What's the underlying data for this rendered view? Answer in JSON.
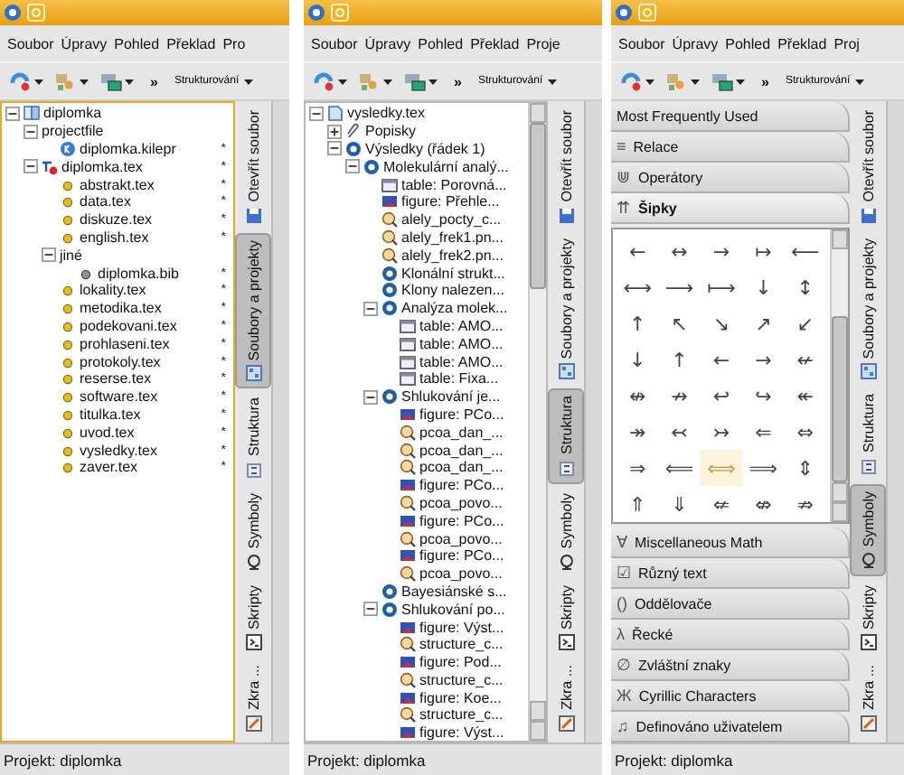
{
  "panels": [
    {
      "menu": [
        "Soubor",
        "Úpravy",
        "Pohled",
        "Překlad",
        "Pro"
      ],
      "toolbar": {
        "overflow": "»",
        "combo": "Strukturování"
      },
      "side_tabs": [
        {
          "label": "Otevřít soubor",
          "selected": false
        },
        {
          "label": "Soubory a projekty",
          "selected": true
        },
        {
          "label": "Struktura",
          "selected": false
        },
        {
          "label": "Symboly",
          "selected": false
        },
        {
          "label": "Skripty",
          "selected": false
        },
        {
          "label": "Zkra ...",
          "selected": false
        }
      ],
      "content": {
        "kind": "tree",
        "scrollbar": false,
        "tree": [
          {
            "label": "diplomka",
            "kind": "project",
            "expanded": true,
            "children": [
              {
                "label": "projectfile",
                "kind": "group",
                "expanded": true,
                "children": [
                  {
                    "label": "diplomka.kilepr",
                    "kind": "kilepr",
                    "flag": "*"
                  }
                ]
              },
              {
                "label": "diplomka.tex",
                "kind": "master",
                "flag": "*",
                "expanded": true,
                "children": [
                  {
                    "label": "abstrakt.tex",
                    "kind": "tex",
                    "flag": "*"
                  },
                  {
                    "label": "data.tex",
                    "kind": "tex",
                    "flag": "*"
                  },
                  {
                    "label": "diskuze.tex",
                    "kind": "tex",
                    "flag": "*"
                  },
                  {
                    "label": "english.tex",
                    "kind": "tex",
                    "flag": "*"
                  },
                  {
                    "label": "jiné",
                    "kind": "group",
                    "expanded": true,
                    "children": [
                      {
                        "label": "diplomka.bib",
                        "kind": "bib",
                        "flag": "*"
                      }
                    ]
                  },
                  {
                    "label": "lokality.tex",
                    "kind": "tex",
                    "flag": "*"
                  },
                  {
                    "label": "metodika.tex",
                    "kind": "tex",
                    "flag": "*"
                  },
                  {
                    "label": "podekovani.tex",
                    "kind": "tex",
                    "flag": "*"
                  },
                  {
                    "label": "prohlaseni.tex",
                    "kind": "tex",
                    "flag": "*"
                  },
                  {
                    "label": "protokoly.tex",
                    "kind": "tex",
                    "flag": "*"
                  },
                  {
                    "label": "reserse.tex",
                    "kind": "tex",
                    "flag": "*"
                  },
                  {
                    "label": "software.tex",
                    "kind": "tex",
                    "flag": "*"
                  },
                  {
                    "label": "titulka.tex",
                    "kind": "tex",
                    "flag": "*"
                  },
                  {
                    "label": "uvod.tex",
                    "kind": "tex",
                    "flag": "*"
                  },
                  {
                    "label": "vysledky.tex",
                    "kind": "tex",
                    "flag": "*"
                  },
                  {
                    "label": "zaver.tex",
                    "kind": "tex",
                    "flag": "*"
                  }
                ]
              }
            ]
          }
        ]
      },
      "status": "Projekt: diplomka"
    },
    {
      "menu": [
        "Soubor",
        "Úpravy",
        "Pohled",
        "Překlad",
        "Proje"
      ],
      "toolbar": {
        "overflow": "»",
        "combo": "Strukturování"
      },
      "side_tabs": [
        {
          "label": "Otevřít soubor",
          "selected": false
        },
        {
          "label": "Soubory a projekty",
          "selected": false
        },
        {
          "label": "Struktura",
          "selected": true
        },
        {
          "label": "Symboly",
          "selected": false
        },
        {
          "label": "Skripty",
          "selected": false
        },
        {
          "label": "Zkra ...",
          "selected": false
        }
      ],
      "content": {
        "kind": "tree",
        "scrollbar": true,
        "tree": [
          {
            "label": "vysledky.tex",
            "kind": "file",
            "expanded": true,
            "children": [
              {
                "label": "Popisky",
                "kind": "labels",
                "expanded": false
              },
              {
                "label": "Výsledky (řádek 1)",
                "kind": "section",
                "expanded": true,
                "children": [
                  {
                    "label": "Molekulární analý...",
                    "kind": "section",
                    "expanded": true,
                    "children": [
                      {
                        "label": "table: Porovná...",
                        "kind": "table"
                      },
                      {
                        "label": "figure: Přehle...",
                        "kind": "figure"
                      },
                      {
                        "label": "alely_pocty_c...",
                        "kind": "graphic"
                      },
                      {
                        "label": "alely_frek1.pn...",
                        "kind": "graphic"
                      },
                      {
                        "label": "alely_frek2.pn...",
                        "kind": "graphic"
                      },
                      {
                        "label": "Klonální strukt...",
                        "kind": "section"
                      },
                      {
                        "label": "Klony nalezen...",
                        "kind": "section"
                      },
                      {
                        "label": "Analýza molek...",
                        "kind": "section",
                        "expanded": true,
                        "children": [
                          {
                            "label": "table: AMO...",
                            "kind": "table"
                          },
                          {
                            "label": "table: AMO...",
                            "kind": "table"
                          },
                          {
                            "label": "table: AMO...",
                            "kind": "table"
                          },
                          {
                            "label": "table: Fixa...",
                            "kind": "table"
                          }
                        ]
                      },
                      {
                        "label": "Shlukování je...",
                        "kind": "section",
                        "expanded": true,
                        "children": [
                          {
                            "label": "figure: PCo...",
                            "kind": "figure"
                          },
                          {
                            "label": "pcoa_dan_...",
                            "kind": "graphic"
                          },
                          {
                            "label": "pcoa_dan_...",
                            "kind": "graphic"
                          },
                          {
                            "label": "pcoa_dan_...",
                            "kind": "graphic"
                          },
                          {
                            "label": "figure: PCo...",
                            "kind": "figure"
                          },
                          {
                            "label": "pcoa_povo...",
                            "kind": "graphic"
                          },
                          {
                            "label": "figure: PCo...",
                            "kind": "figure"
                          },
                          {
                            "label": "pcoa_povo...",
                            "kind": "graphic"
                          },
                          {
                            "label": "figure: PCo...",
                            "kind": "figure"
                          },
                          {
                            "label": "pcoa_povo...",
                            "kind": "graphic"
                          }
                        ]
                      },
                      {
                        "label": "Bayesiánské s...",
                        "kind": "section"
                      },
                      {
                        "label": "Shlukování po...",
                        "kind": "section",
                        "expanded": true,
                        "children": [
                          {
                            "label": "figure: Výst...",
                            "kind": "figure"
                          },
                          {
                            "label": "structure_c...",
                            "kind": "graphic"
                          },
                          {
                            "label": "figure: Pod...",
                            "kind": "figure"
                          },
                          {
                            "label": "structure_c...",
                            "kind": "graphic"
                          },
                          {
                            "label": "figure: Koe...",
                            "kind": "figure"
                          },
                          {
                            "label": "structure_c...",
                            "kind": "graphic"
                          },
                          {
                            "label": "figure: Výst...",
                            "kind": "figure"
                          }
                        ]
                      }
                    ]
                  }
                ]
              }
            ]
          }
        ]
      },
      "status": "Projekt: diplomka"
    },
    {
      "menu": [
        "Soubor",
        "Úpravy",
        "Pohled",
        "Překlad",
        "Proj"
      ],
      "toolbar": {
        "overflow": "»",
        "combo": "Strukturování"
      },
      "side_tabs": [
        {
          "label": "Otevřít soubor",
          "selected": false
        },
        {
          "label": "Soubory a projekty",
          "selected": false
        },
        {
          "label": "Struktura",
          "selected": false
        },
        {
          "label": "Symboly",
          "selected": true
        },
        {
          "label": "Skripty",
          "selected": false
        },
        {
          "label": "Zkra ...",
          "selected": false
        }
      ],
      "content": {
        "kind": "symbols",
        "groups": [
          {
            "label": "Most Frequently Used",
            "selected": false
          },
          {
            "label": "Relace",
            "glyph": "≡",
            "selected": false
          },
          {
            "label": "Operátory",
            "glyph": "⋓",
            "selected": false
          },
          {
            "label": "Šipky",
            "glyph": "⇈",
            "selected": true,
            "symbols": [
              [
                {
                  "glyph": "←",
                  "selected": false
                },
                {
                  "glyph": "↔",
                  "selected": false
                },
                {
                  "glyph": "→",
                  "selected": false
                },
                {
                  "glyph": "↦",
                  "selected": false
                },
                {
                  "glyph": "⟵",
                  "selected": false
                }
              ],
              [
                {
                  "glyph": "⟷",
                  "selected": false
                },
                {
                  "glyph": "⟶",
                  "selected": false
                },
                {
                  "glyph": "⟼",
                  "selected": false
                },
                {
                  "glyph": "↓",
                  "selected": false
                },
                {
                  "glyph": "↕",
                  "selected": false
                }
              ],
              [
                {
                  "glyph": "↑",
                  "selected": false
                },
                {
                  "glyph": "↖",
                  "selected": false
                },
                {
                  "glyph": "↘",
                  "selected": false
                },
                {
                  "glyph": "↗",
                  "selected": false
                },
                {
                  "glyph": "↙",
                  "selected": false
                }
              ],
              [
                {
                  "glyph": "↓",
                  "selected": false
                },
                {
                  "glyph": "↑",
                  "selected": false
                },
                {
                  "glyph": "←",
                  "selected": false
                },
                {
                  "glyph": "→",
                  "selected": false
                },
                {
                  "glyph": "↚",
                  "selected": false
                }
              ],
              [
                {
                  "glyph": "↮",
                  "selected": false
                },
                {
                  "glyph": "↛",
                  "selected": false
                },
                {
                  "glyph": "↩",
                  "selected": false
                },
                {
                  "glyph": "↪",
                  "selected": false
                },
                {
                  "glyph": "↞",
                  "selected": false
                }
              ],
              [
                {
                  "glyph": "↠",
                  "selected": false
                },
                {
                  "glyph": "↢",
                  "selected": false
                },
                {
                  "glyph": "↣",
                  "selected": false
                },
                {
                  "glyph": "⇐",
                  "selected": false
                },
                {
                  "glyph": "⇔",
                  "selected": false
                }
              ],
              [
                {
                  "glyph": "⇒",
                  "selected": false
                },
                {
                  "glyph": "⟸",
                  "selected": false
                },
                {
                  "glyph": "⟺",
                  "selected": true
                },
                {
                  "glyph": "⟹",
                  "selected": false
                },
                {
                  "glyph": "⇕",
                  "selected": false
                }
              ],
              [
                {
                  "glyph": "⇑",
                  "selected": false
                },
                {
                  "glyph": "⇓",
                  "selected": false
                },
                {
                  "glyph": "⇍",
                  "selected": false
                },
                {
                  "glyph": "⇎",
                  "selected": false
                },
                {
                  "glyph": "⇏",
                  "selected": false
                }
              ]
            ]
          },
          {
            "label": "Miscellaneous Math",
            "glyph": "∀",
            "selected": false
          },
          {
            "label": "Různý text",
            "glyph": "☑",
            "selected": false
          },
          {
            "label": "Oddělovače",
            "glyph": "()",
            "selected": false
          },
          {
            "label": "Řecké",
            "glyph": "λ",
            "selected": false
          },
          {
            "label": "Zvláštní znaky",
            "glyph": "∅",
            "selected": false
          },
          {
            "label": "Cyrillic Characters",
            "glyph": "Ж",
            "selected": false
          },
          {
            "label": "Definováno uživatelem",
            "glyph": "♫",
            "selected": false
          }
        ]
      },
      "status": "Projekt: diplomka"
    }
  ]
}
